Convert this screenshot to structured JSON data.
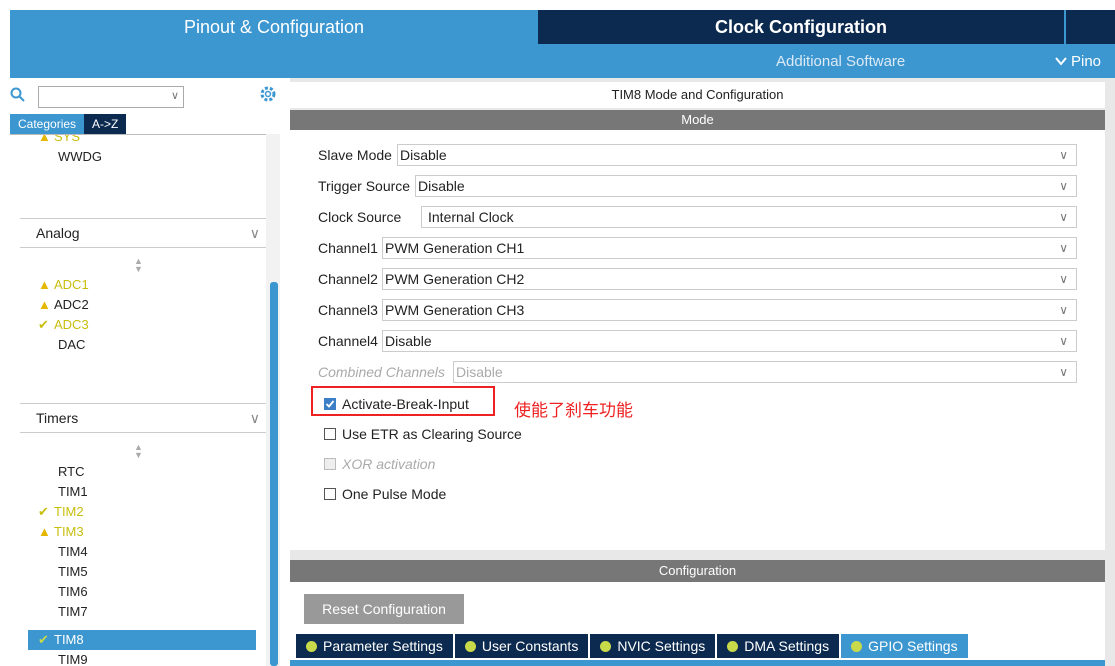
{
  "header": {
    "tabs": [
      "Pinout & Configuration",
      "Clock Configuration"
    ],
    "sub_additional": "Additional Software",
    "sub_pinout": "Pino",
    "sub_pinout_chevron": "chevron-down-icon"
  },
  "left": {
    "category_tabs": [
      "Categories",
      "A->Z"
    ],
    "search_placeholder": "",
    "system_items": [
      {
        "label": "SYS",
        "status": "warn"
      },
      {
        "label": "WWDG",
        "status": "none"
      }
    ],
    "analog": {
      "title": "Analog",
      "items": [
        {
          "label": "ADC1",
          "status": "warn"
        },
        {
          "label": "ADC2",
          "status": "warn"
        },
        {
          "label": "ADC3",
          "status": "ok"
        },
        {
          "label": "DAC",
          "status": "none"
        }
      ]
    },
    "timers": {
      "title": "Timers",
      "items": [
        {
          "label": "RTC",
          "status": "none"
        },
        {
          "label": "TIM1",
          "status": "none"
        },
        {
          "label": "TIM2",
          "status": "ok"
        },
        {
          "label": "TIM3",
          "status": "warn"
        },
        {
          "label": "TIM4",
          "status": "none"
        },
        {
          "label": "TIM5",
          "status": "none"
        },
        {
          "label": "TIM6",
          "status": "none"
        },
        {
          "label": "TIM7",
          "status": "none"
        },
        {
          "label": "TIM8",
          "status": "ok-selected"
        },
        {
          "label": "TIM9",
          "status": "none"
        }
      ]
    }
  },
  "panel": {
    "title": "TIM8 Mode and Configuration",
    "mode_header": "Mode",
    "fields": [
      {
        "label": "Slave Mode",
        "value": "Disable"
      },
      {
        "label": "Trigger Source",
        "value": "Disable"
      },
      {
        "label": "Clock Source",
        "value": "Internal Clock"
      },
      {
        "label": "Channel1",
        "value": "PWM Generation CH1"
      },
      {
        "label": "Channel2",
        "value": "PWM Generation CH2"
      },
      {
        "label": "Channel3",
        "value": "PWM Generation CH3"
      },
      {
        "label": "Channel4",
        "value": "Disable"
      },
      {
        "label": "Combined Channels",
        "value": "Disable",
        "disabled": true
      }
    ],
    "checkboxes": [
      {
        "label": "Activate-Break-Input",
        "checked": true
      },
      {
        "label": "Use ETR as Clearing Source",
        "checked": false
      },
      {
        "label": "XOR activation",
        "checked": false,
        "disabled": true
      },
      {
        "label": "One Pulse Mode",
        "checked": false
      }
    ],
    "annotation": "使能了刹车功能",
    "config_header": "Configuration",
    "reset_label": "Reset Configuration",
    "bottom_tabs": [
      "Parameter Settings",
      "User Constants",
      "NVIC Settings",
      "DMA Settings",
      "GPIO Settings"
    ],
    "active_bottom_tab": "GPIO Settings"
  },
  "colors": {
    "accent": "#3c97d0",
    "dark_tab": "#0c2a4f",
    "annotation_red": "#e22222",
    "status_ok": "#c8be0d",
    "status_warn": "#e4b800"
  }
}
